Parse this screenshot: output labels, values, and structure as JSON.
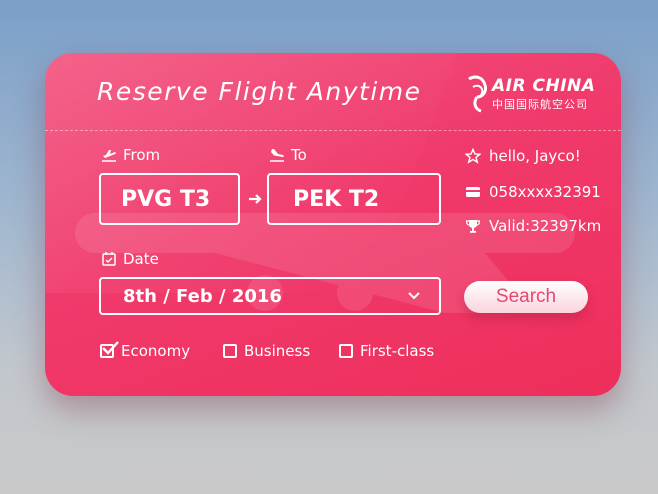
{
  "card": {
    "title": "Reserve Flight Anytime",
    "brand": {
      "name": "AIR CHINA",
      "subtitle": "中国国际航空公司"
    },
    "from": {
      "label": "From",
      "value": "PVG T3"
    },
    "to": {
      "label": "To",
      "value": "PEK T2"
    },
    "date": {
      "label": "Date",
      "value": "8th / Feb / 2016"
    },
    "user": {
      "greeting": "hello, Jayco!",
      "card_number": "058xxxx32391",
      "valid": "Valid:32397km"
    },
    "search_label": "Search",
    "classes": [
      {
        "label": "Economy",
        "checked": true
      },
      {
        "label": "Business",
        "checked": false
      },
      {
        "label": "First-class",
        "checked": false
      }
    ]
  },
  "colors": {
    "card_gradient_start": "#f2527e",
    "card_gradient_end": "#ee2e5b",
    "search_text": "#e8456f",
    "text": "#ffffff"
  },
  "icons": [
    "plane-takeoff-icon",
    "plane-landing-icon",
    "calendar-icon",
    "arrow-right-icon",
    "chevron-down-icon",
    "star-icon",
    "credit-card-icon",
    "trophy-icon",
    "checkbox-icon",
    "air-china-logo"
  ]
}
